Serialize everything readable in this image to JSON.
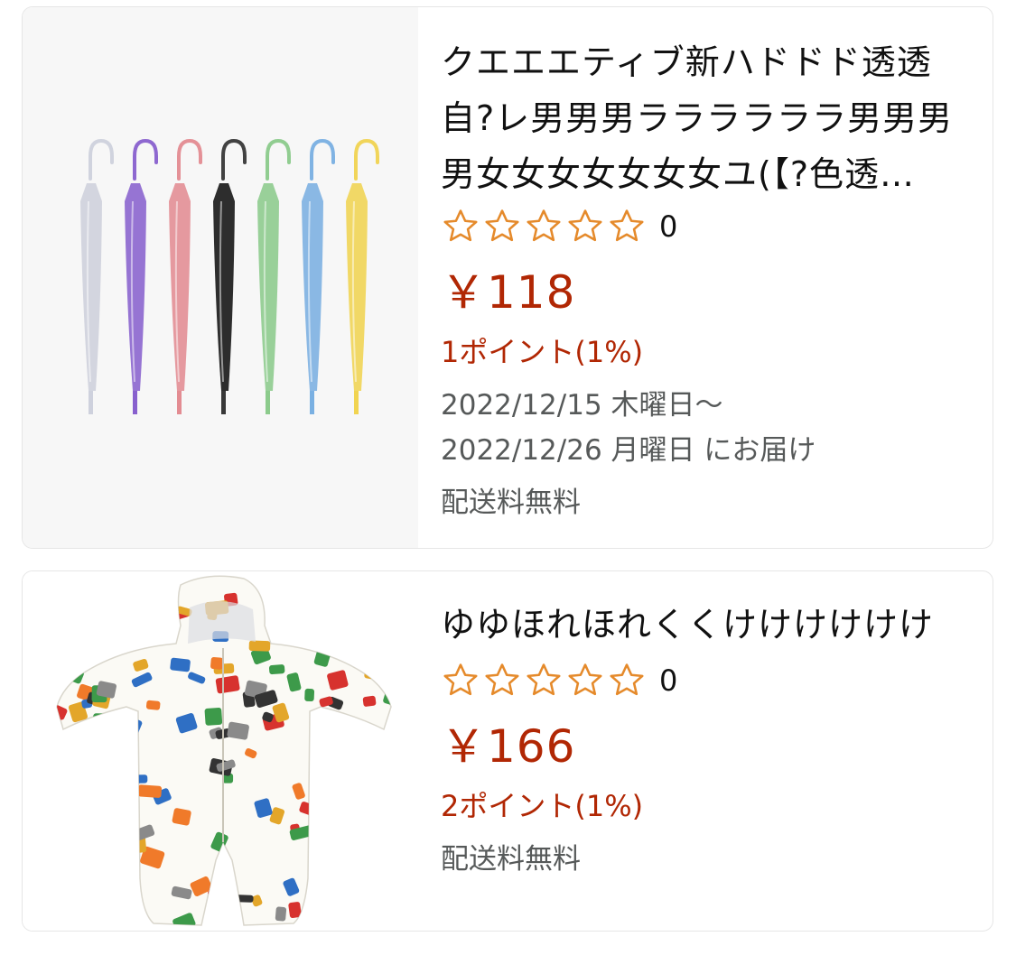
{
  "products": [
    {
      "title": "クエエエティブ新ハドドド透透自?レ男男男ララララララ男男男男女女女女女女女ユ(【?色透…",
      "image_alt": "umbrellas",
      "rating_count": "0",
      "price": "￥118",
      "points": "1ポイント(1%)",
      "delivery_line1": "2022/12/15 木曜日〜",
      "delivery_line2": "2022/12/26 月曜日 にお届け",
      "shipping": "配送料無料"
    },
    {
      "title": "ゆゆほれほれくくけけけけけけ",
      "image_alt": "raincoat",
      "rating_count": "0",
      "price": "￥166",
      "points": "2ポイント(1%)",
      "shipping": "配送料無料"
    }
  ],
  "colors": {
    "price": "#b12704",
    "star_outline": "#e58a2b",
    "muted_text": "#565959"
  },
  "umbrella_colors": [
    "#c9ccd9",
    "#7b4fc9",
    "#e07f86",
    "#222222",
    "#7fc57f",
    "#6ba7df",
    "#f0cf3e"
  ]
}
